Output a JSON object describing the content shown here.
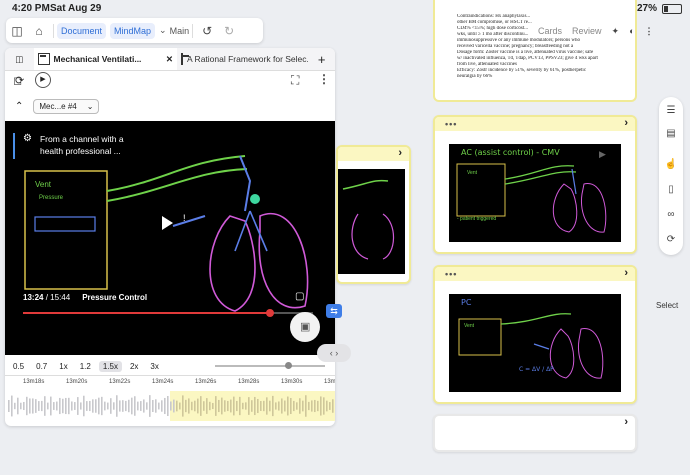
{
  "status_bar": {
    "time": "4:20 PM",
    "date": "Sat Aug 29",
    "battery": "27%"
  },
  "toolbar": {
    "document_label": "Document",
    "mindmap_label": "MindMap",
    "main_label": "Main"
  },
  "tabs": [
    {
      "label": "Mechanical Ventilati..."
    },
    {
      "label": "A Rational Framework for Selec..."
    }
  ],
  "chooser": {
    "value": "Mec...e #4"
  },
  "video": {
    "title_line1": "From a channel with a",
    "title_line2": "health professional ...",
    "current_time": "13:24",
    "separator": "/",
    "duration": "15:44",
    "chapter": "Pressure Control",
    "progress_fraction": 0.85
  },
  "speeds": [
    "0.5",
    "0.7",
    "1x",
    "1.2",
    "1.5x",
    "2x",
    "3x"
  ],
  "speed_selected": "1.5x",
  "timeline_labels": [
    "13m18s",
    "13m20s",
    "13m22s",
    "13m24s",
    "13m26s",
    "13m28s",
    "13m30s",
    "13m32s"
  ],
  "document_lines": [
    "Contraindications: Hx anaphylaxis...",
    "other BM compromise, or HSCT re...",
    "CD4% <15%; high dose corticost...",
    "wks, until ≥ 1 mo after discontinu...",
    "immunosuppressive or any immune modulators; persons who",
    "received varicella vaccine; pregnancy; breastfeeding not a",
    "Dosage form: Zoster vaccine is a live, attenuated virus vaccine; safe",
    "w/ inactivated influenza, Td, Tdap, PCV13, PPSV23; give 4 wks apart",
    "from live, attenuated vaccines",
    "Efficacy: Zostr incidence by 51%, severity by 61%, postherpetic",
    "neuralgia by 66%"
  ],
  "top_menu": {
    "cards": "Cards",
    "review": "Review"
  },
  "note_cards": [
    {
      "label": "AC (assist control) - CMV",
      "sub": "- patient triggered"
    },
    {
      "label": "PC",
      "sub": "C = ΔV / ΔP"
    }
  ],
  "side_actions": {
    "select": "Select"
  },
  "colors": {
    "accent": "#2f6fd6",
    "note_border": "#f0ea96",
    "note_header": "#fbf7c2",
    "progress": "#e03a3a"
  }
}
